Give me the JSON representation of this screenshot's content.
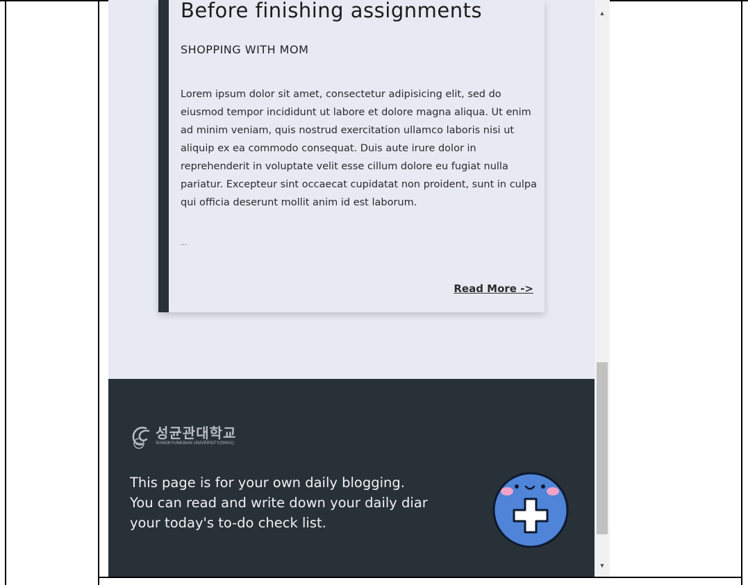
{
  "card": {
    "title": "Before finishing assignments",
    "subtitle": "Shopping with mom",
    "body": "Lorem ipsum dolor sit amet, consectetur adipisicing elit, sed do eiusmod tempor incididunt ut labore et dolore magna aliqua. Ut enim ad minim veniam, quis nostrud exercitation ullamco laboris nisi ut aliquip ex ea commodo consequat. Duis aute irure dolor in reprehenderit in voluptate velit esse cillum dolore eu fugiat nulla pariatur. Excepteur sint occaecat cupidatat non proident, sunt in culpa qui officia deserunt mollit anim id est laborum.",
    "ellipsis": "...",
    "read_more": "Read More ->"
  },
  "footer": {
    "logo_korean": "성균관대학교",
    "logo_english": "SUNGKYUNKWAN UNIVERSITY(SKKU)",
    "logo_mark_text": "1398",
    "line1": "This page is for your own daily blogging.",
    "line2": "You can read and write down your daily diar",
    "line3": "your today's to-do check list."
  },
  "scrollbar": {
    "up_arrow": "▲",
    "down_arrow": "▼"
  },
  "colors": {
    "page_bg": "#e8eaf3",
    "dark": "#283038",
    "fab_blue": "#4f84d8",
    "fab_cheek": "#f3a3c8"
  },
  "icons": {
    "fab": "smiling-plus-face-icon",
    "logo": "skku-logo-icon"
  }
}
